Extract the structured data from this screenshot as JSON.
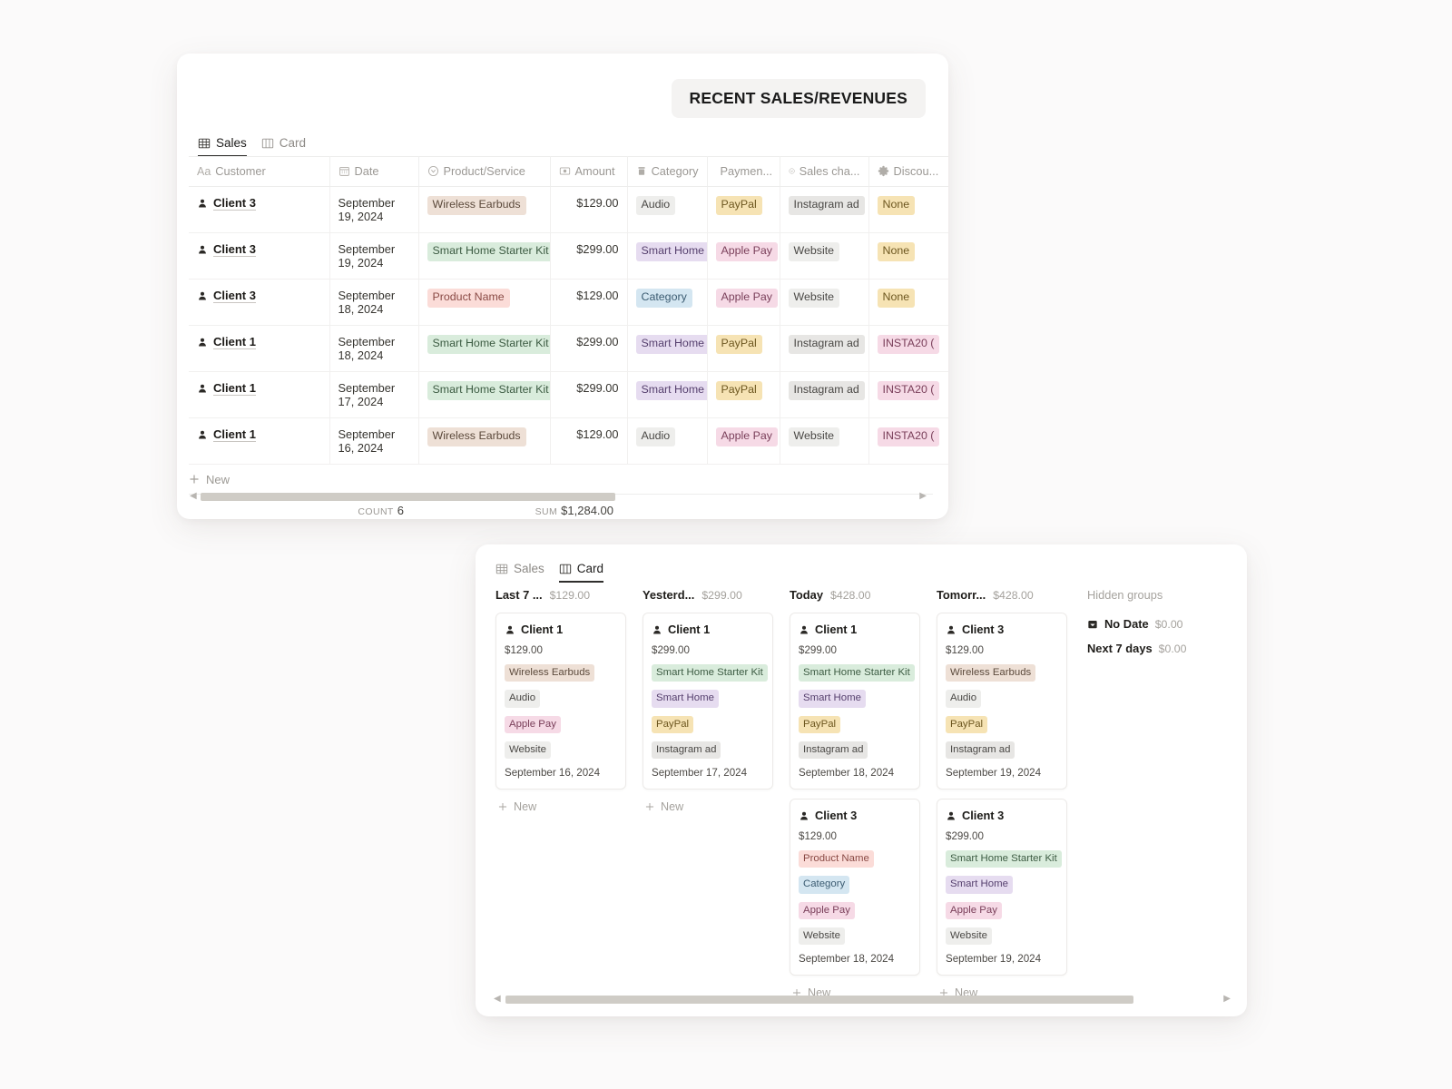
{
  "title_badge": "RECENT SALES/REVENUES",
  "table_view": {
    "tabs": [
      {
        "label": "Sales",
        "icon": "table-icon",
        "active": true
      },
      {
        "label": "Card",
        "icon": "board-icon",
        "active": false
      }
    ],
    "columns": [
      {
        "label": "Customer",
        "icon": "title-aa-icon"
      },
      {
        "label": "Date",
        "icon": "calendar-icon"
      },
      {
        "label": "Product/Service",
        "icon": "select-icon"
      },
      {
        "label": "Amount",
        "icon": "currency-icon"
      },
      {
        "label": "Category",
        "icon": "multiselect-icon"
      },
      {
        "label": "Paymen...",
        "icon": "relation-icon"
      },
      {
        "label": "Sales cha...",
        "icon": "select-icon"
      },
      {
        "label": "Discou...",
        "icon": "gear-icon"
      }
    ],
    "rows": [
      {
        "customer": "Client 3",
        "date": "September 19, 2024",
        "product": "Wireless Earbuds",
        "amount": "$129.00",
        "category": "Audio",
        "payment": "PayPal",
        "channel": "Instagram ad",
        "discount": "None"
      },
      {
        "customer": "Client 3",
        "date": "September 19, 2024",
        "product": "Smart Home Starter Kit",
        "amount": "$299.00",
        "category": "Smart Home",
        "payment": "Apple Pay",
        "channel": "Website",
        "discount": "None"
      },
      {
        "customer": "Client 3",
        "date": "September 18, 2024",
        "product": "Product Name",
        "amount": "$129.00",
        "category": "Category",
        "payment": "Apple Pay",
        "channel": "Website",
        "discount": "None"
      },
      {
        "customer": "Client 1",
        "date": "September 18, 2024",
        "product": "Smart Home Starter Kit",
        "amount": "$299.00",
        "category": "Smart Home",
        "payment": "PayPal",
        "channel": "Instagram ad",
        "discount": "INSTA20 ("
      },
      {
        "customer": "Client 1",
        "date": "September 17, 2024",
        "product": "Smart Home Starter Kit",
        "amount": "$299.00",
        "category": "Smart Home",
        "payment": "PayPal",
        "channel": "Instagram ad",
        "discount": "INSTA20 ("
      },
      {
        "customer": "Client 1",
        "date": "September 16, 2024",
        "product": "Wireless Earbuds",
        "amount": "$129.00",
        "category": "Audio",
        "payment": "Apple Pay",
        "channel": "Website",
        "discount": "INSTA20 ("
      }
    ],
    "new_row_label": "New",
    "summary": {
      "count_label": "COUNT",
      "count_value": "6",
      "sum_label": "SUM",
      "sum_value": "$1,284.00"
    }
  },
  "card_view": {
    "tabs": [
      {
        "label": "Sales",
        "icon": "table-icon",
        "active": false
      },
      {
        "label": "Card",
        "icon": "board-icon",
        "active": true
      }
    ],
    "groups": [
      {
        "name": "Last 7 ...",
        "sum": "$129.00",
        "new_label": "New",
        "cards": [
          {
            "customer": "Client 1",
            "amount": "$129.00",
            "product": "Wireless Earbuds",
            "category": "Audio",
            "payment": "Apple Pay",
            "channel": "Website",
            "date": "September 16, 2024"
          }
        ]
      },
      {
        "name": "Yesterd...",
        "sum": "$299.00",
        "new_label": "New",
        "cards": [
          {
            "customer": "Client 1",
            "amount": "$299.00",
            "product": "Smart Home Starter Kit",
            "category": "Smart Home",
            "payment": "PayPal",
            "channel": "Instagram ad",
            "date": "September 17, 2024"
          }
        ]
      },
      {
        "name": "Today",
        "sum": "$428.00",
        "new_label": "New",
        "cards": [
          {
            "customer": "Client 1",
            "amount": "$299.00",
            "product": "Smart Home Starter Kit",
            "category": "Smart Home",
            "payment": "PayPal",
            "channel": "Instagram ad",
            "date": "September 18, 2024"
          },
          {
            "customer": "Client 3",
            "amount": "$129.00",
            "product": "Product Name",
            "category": "Category",
            "payment": "Apple Pay",
            "channel": "Website",
            "date": "September 18, 2024"
          }
        ]
      },
      {
        "name": "Tomorr...",
        "sum": "$428.00",
        "new_label": "New",
        "cards": [
          {
            "customer": "Client 3",
            "amount": "$129.00",
            "product": "Wireless Earbuds",
            "category": "Audio",
            "payment": "PayPal",
            "channel": "Instagram ad",
            "date": "September 19, 2024"
          },
          {
            "customer": "Client 3",
            "amount": "$299.00",
            "product": "Smart Home Starter Kit",
            "category": "Smart Home",
            "payment": "Apple Pay",
            "channel": "Website",
            "date": "September 19, 2024"
          }
        ]
      }
    ],
    "hidden_groups": {
      "title": "Hidden groups",
      "rows": [
        {
          "name": "No Date",
          "sum": "$0.00",
          "icon": "archive-icon"
        },
        {
          "name": "Next 7 days",
          "sum": "$0.00",
          "icon": ""
        }
      ]
    }
  },
  "tag_colors": {
    "Wireless Earbuds": {
      "bg": "#eee0d6",
      "fg": "#5c4a3c"
    },
    "Smart Home Starter Kit": {
      "bg": "#d9ecdc",
      "fg": "#3d5c43"
    },
    "Product Name": {
      "bg": "#fbdcd8",
      "fg": "#8a4a45"
    },
    "Audio": {
      "bg": "#eeeeec",
      "fg": "#4a4845"
    },
    "Smart Home": {
      "bg": "#e6dcf0",
      "fg": "#56406e"
    },
    "Category": {
      "bg": "#d4e6f1",
      "fg": "#3c5c72"
    },
    "PayPal": {
      "bg": "#f6e3b4",
      "fg": "#6d5720"
    },
    "Apple Pay": {
      "bg": "#f6dae6",
      "fg": "#7a3f5a"
    },
    "Instagram ad": {
      "bg": "#e7e6e4",
      "fg": "#4a4845"
    },
    "Website": {
      "bg": "#eeeeec",
      "fg": "#4a4845"
    },
    "None": {
      "bg": "#f6e3b4",
      "fg": "#6d5720"
    },
    "INSTA20 (": {
      "bg": "#f6dae6",
      "fg": "#7a3f5a"
    }
  }
}
